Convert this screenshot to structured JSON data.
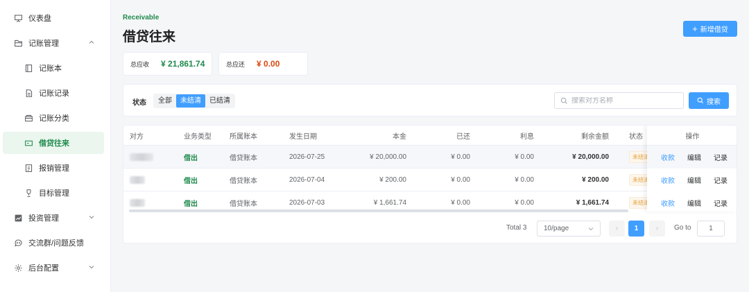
{
  "sidebar": {
    "items": [
      {
        "label": "仪表盘"
      },
      {
        "label": "记账管理"
      },
      {
        "label": "记账本"
      },
      {
        "label": "记账记录"
      },
      {
        "label": "记账分类"
      },
      {
        "label": "借贷往来"
      },
      {
        "label": "报销管理"
      },
      {
        "label": "目标管理"
      },
      {
        "label": "投资管理"
      },
      {
        "label": "交流群/问题反馈"
      },
      {
        "label": "后台配置"
      }
    ]
  },
  "header": {
    "eyebrow": "Receivable",
    "title": "借贷往来",
    "new_button": "新增借贷"
  },
  "summary": {
    "receivable_label": "总应收",
    "receivable_value": "¥ 21,861.74",
    "payable_label": "总应还",
    "payable_value": "¥ 0.00"
  },
  "filter": {
    "label": "状态",
    "options": [
      "全部",
      "未结清",
      "已结清"
    ],
    "selected": "未结清",
    "search_placeholder": "搜索对方名称",
    "search_button": "搜索"
  },
  "table": {
    "columns": [
      "对方",
      "业务类型",
      "所属账本",
      "发生日期",
      "本金",
      "已还",
      "利息",
      "剩余金额",
      "状态",
      "操作"
    ],
    "rows": [
      {
        "type": "借出",
        "account": "借贷账本",
        "date": "2026-07-25",
        "principal": "¥ 20,000.00",
        "paid": "¥ 0.00",
        "interest": "¥ 0.00",
        "remaining": "¥ 20,000.00",
        "status": "未结清"
      },
      {
        "type": "借出",
        "account": "借贷账本",
        "date": "2026-07-04",
        "principal": "¥ 200.00",
        "paid": "¥ 0.00",
        "interest": "¥ 0.00",
        "remaining": "¥ 200.00",
        "status": "未结清"
      },
      {
        "type": "借出",
        "account": "借贷账本",
        "date": "2026-07-03",
        "principal": "¥ 1,661.74",
        "paid": "¥ 0.00",
        "interest": "¥ 0.00",
        "remaining": "¥ 1,661.74",
        "status": "未结清"
      }
    ],
    "actions": [
      "收款",
      "编辑",
      "记录"
    ]
  },
  "pagination": {
    "total": "Total 3",
    "page_size": "10/page",
    "current_page": "1",
    "goto_label": "Go to",
    "goto_value": "1"
  },
  "colors": {
    "accent": "#409eff",
    "green": "#1f8a4c",
    "orange": "#d9480f",
    "warning": "#e6a23c"
  }
}
